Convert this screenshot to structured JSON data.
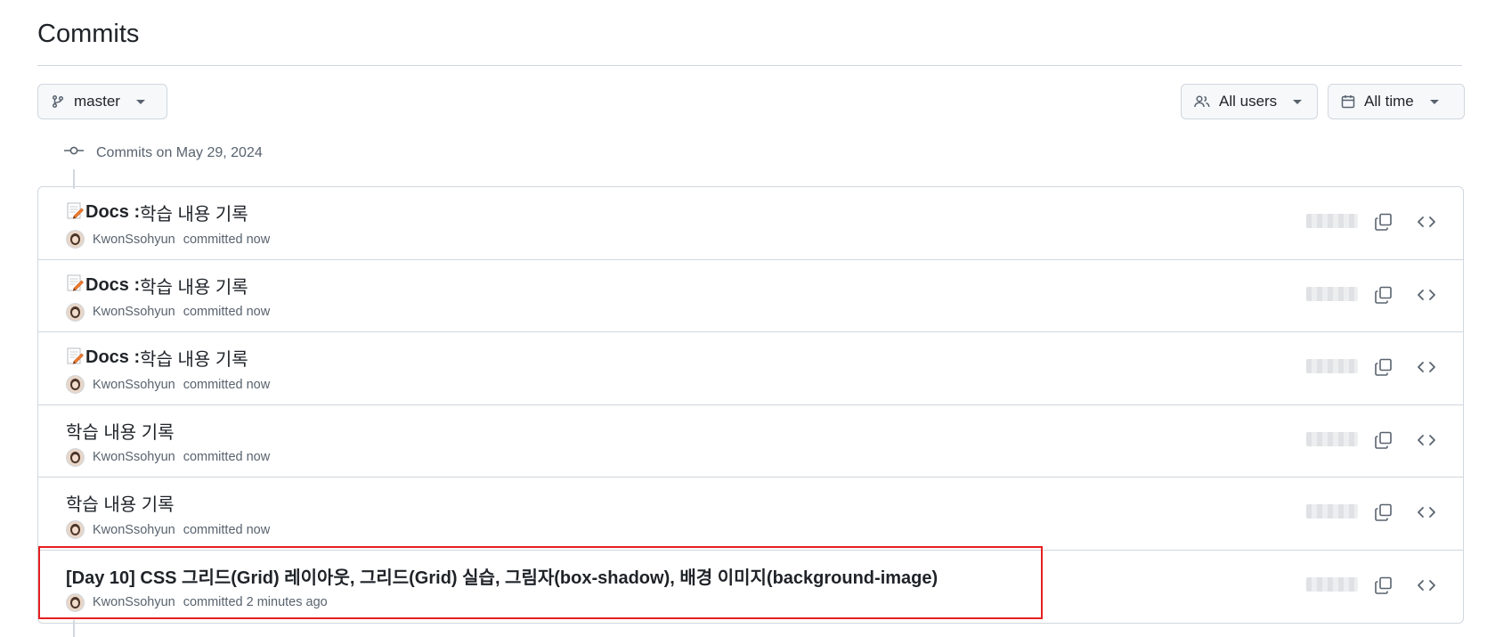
{
  "page": {
    "title": "Commits"
  },
  "filters": {
    "branch": {
      "label": "master",
      "icon": "git-branch-icon"
    },
    "users": {
      "label": "All users",
      "icon": "people-icon"
    },
    "time": {
      "label": "All time",
      "icon": "calendar-icon"
    }
  },
  "group": {
    "label": "Commits on May 29, 2024",
    "icon": "git-commit-icon"
  },
  "commits": [
    {
      "emoji": "memo-icon",
      "prefix": "Docs : ",
      "message": "학습 내용 기록",
      "author": "KwonSsohyun",
      "when": "committed now"
    },
    {
      "emoji": "memo-icon",
      "prefix": "Docs : ",
      "message": "학습 내용 기록",
      "author": "KwonSsohyun",
      "when": "committed now"
    },
    {
      "emoji": "memo-icon",
      "prefix": "Docs : ",
      "message": "학습 내용 기록",
      "author": "KwonSsohyun",
      "when": "committed now"
    },
    {
      "emoji": "",
      "prefix": "",
      "message": "학습 내용 기록",
      "author": "KwonSsohyun",
      "when": "committed now"
    },
    {
      "emoji": "",
      "prefix": "",
      "message": "학습 내용 기록",
      "author": "KwonSsohyun",
      "when": "committed now"
    },
    {
      "emoji": "",
      "prefix": "",
      "message": "[Day 10] CSS 그리드(Grid) 레이아웃, 그리드(Grid) 실습, 그림자(box-shadow), 배경 이미지(background-image)",
      "author": "KwonSsohyun",
      "when": "committed 2 minutes ago"
    }
  ],
  "colors": {
    "highlight": "#e52020",
    "border": "#d0d7de",
    "muted": "#59636e"
  }
}
